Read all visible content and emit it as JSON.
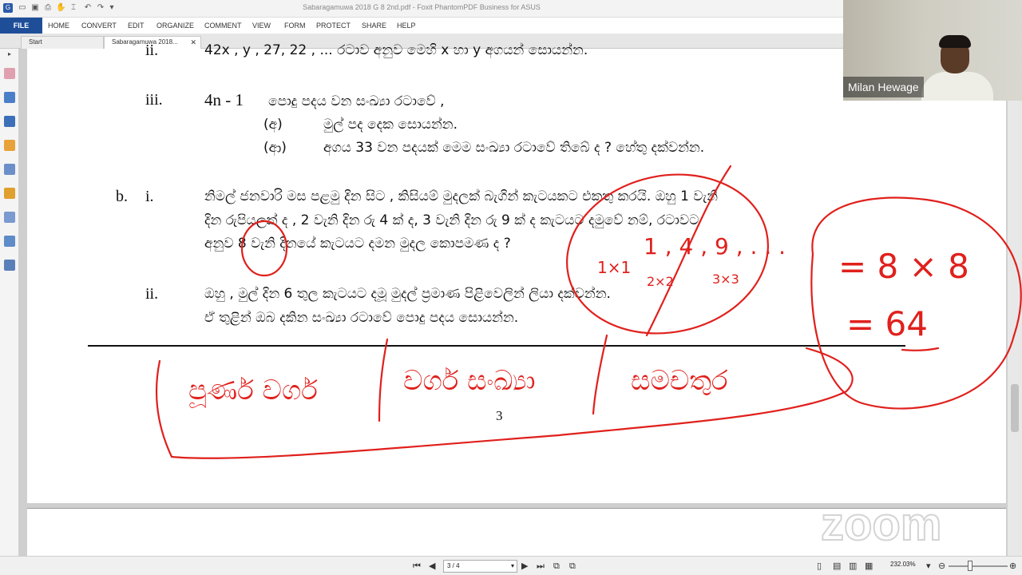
{
  "window": {
    "title": "Sabaragamuwa 2018 G 8 2nd.pdf - Foxit PhantomPDF Business for ASUS"
  },
  "menu": {
    "file": "FILE",
    "items": [
      "HOME",
      "CONVERT",
      "EDIT",
      "ORGANIZE",
      "COMMENT",
      "VIEW",
      "FORM",
      "PROTECT",
      "SHARE",
      "HELP"
    ]
  },
  "tabs": [
    {
      "label": "Start"
    },
    {
      "label": "Sabaragamuwa 2018..."
    }
  ],
  "document": {
    "line_top": {
      "num": "ii.",
      "text": "42x , y , 27, 22 , ...   රටාව අනුව මෙහි x හා y  අගයන් සොයන්න."
    },
    "q_iii": {
      "num": "iii.",
      "formula": "4n - 1",
      "text": "පොදු පදය වන සංඛ්‍යා රටාවේ ,",
      "a_label": "(අ)",
      "a_text": "මුල් පද දෙක සොයන්න.",
      "b_label": "(ආ)",
      "b_text": "අගය 33 වන පදයක් මෙම සංඛ්‍යා රටාවේ තිබේ ද ? හේතු දක්වන්න."
    },
    "q_b": {
      "letter": "b.",
      "num_i": "i.",
      "line1": "නිමල් ජනවාරි මස පළමු දින සිට , කිසියම් මුදලක් බැගින් කැටයකට එකතු කරයි. ඔහු 1 වැනි",
      "line2": "දින රුපියලක් ද , 2 වැනි දින රු 4 ක් ද, 3 වැනි දින රු 9 ක් ද කැටයට දමුවේ නම්, රටාවට",
      "line3": "අනුව 8 වැනි  දිනයේ කැටයට දමන මුදල කොපමණ ද ?",
      "num_ii": "ii.",
      "line4": "ඔහු , මුල් දින 6 තුල කැටයට දමූ මුදල් ප්‍රමාණ පිළිවෙලින් ලියා දක්වන්න.",
      "line5": "ඒ තුළින් ඔබ දකින සංඛ්‍යා රටාවේ පොදු පදය සොයන්න."
    },
    "page_number": "3",
    "handwriting": {
      "seq": "1 , 4 , 9 , . . .",
      "mult1": "1×1",
      "mult2": "2×2",
      "mult3": "3×3",
      "eq1": "= 8 × 8",
      "eq2": "= 64",
      "bottom1": "පූර්ණ වර්ග",
      "bottom2": "වර්ග සංඛ්‍යා",
      "bottom3": "සමචතුර"
    }
  },
  "status": {
    "page_indicator": "3 / 4",
    "zoom": "232.03%"
  },
  "video": {
    "participant": "Milan Hewage"
  },
  "watermark": "zoom",
  "colors": {
    "ink": "#e0201c",
    "ribbon": "#1f4e99"
  }
}
